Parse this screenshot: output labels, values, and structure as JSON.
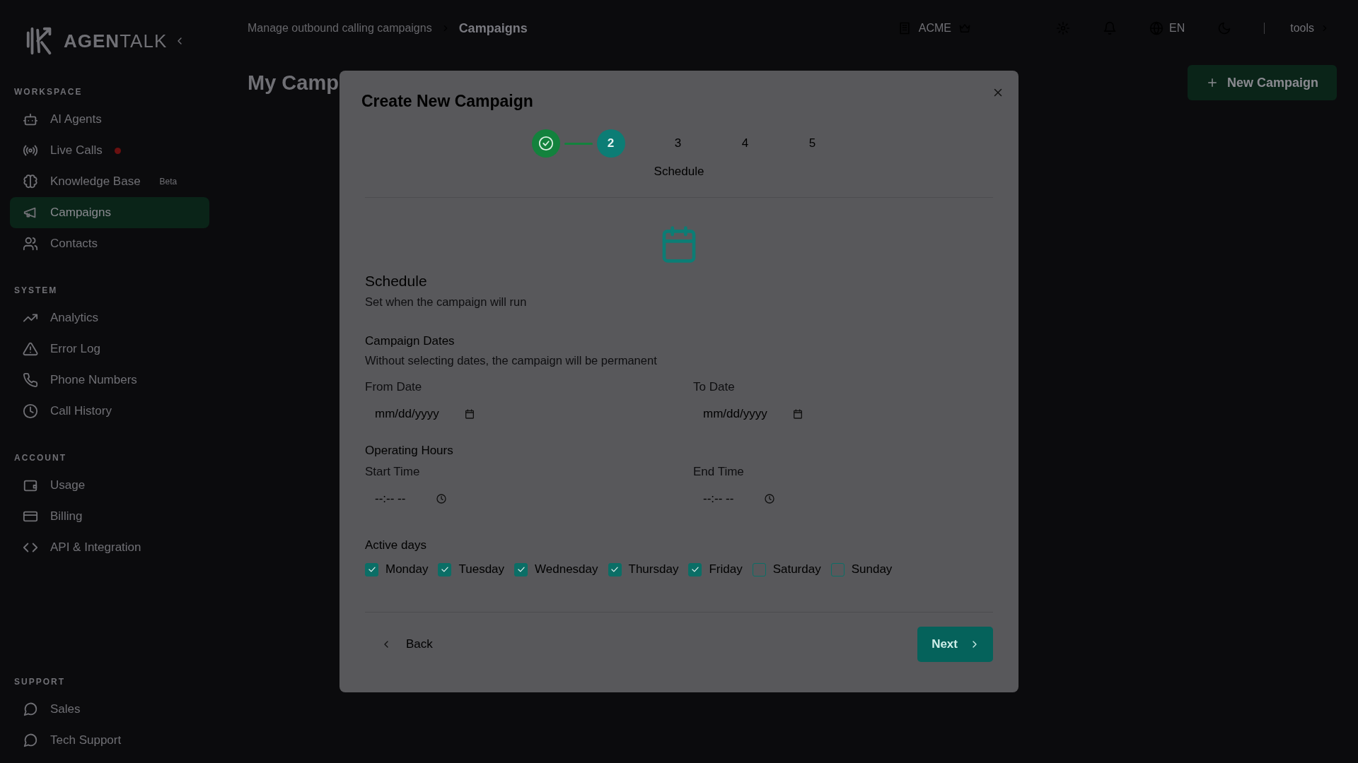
{
  "sidebar": {
    "logo": "**AGEN**TALK",
    "sections": [
      {
        "title": "WORKSPACE",
        "items": [
          {
            "label": "AI Agents",
            "selected": false
          },
          {
            "label": "Live Calls",
            "selected": false,
            "live": true
          },
          {
            "label": "Knowledge Base",
            "selected": false,
            "badge": "Beta"
          },
          {
            "label": "Campaigns",
            "selected": true
          },
          {
            "label": "Contacts",
            "selected": false
          }
        ]
      },
      {
        "title": "SYSTEM",
        "items": [
          {
            "label": "Analytics",
            "selected": false
          },
          {
            "label": "Error Log",
            "selected": false
          },
          {
            "label": "Phone Numbers",
            "selected": false
          },
          {
            "label": "Call History",
            "selected": false
          }
        ]
      },
      {
        "title": "ACCOUNT",
        "items": [
          {
            "label": "Usage",
            "selected": false
          },
          {
            "label": "Billing",
            "selected": false
          },
          {
            "label": "API & Integration",
            "selected": false
          }
        ]
      },
      {
        "title": "SUPPORT",
        "items": [
          {
            "label": "Sales",
            "selected": false
          },
          {
            "label": "Tech Support",
            "selected": false
          }
        ]
      }
    ]
  },
  "topbar": {
    "breadcrumb": [
      "Manage outbound calling campaigns",
      "Campaigns"
    ],
    "organization": "ACME",
    "language": "EN",
    "user": "tools"
  },
  "page": {
    "title": "My Camp",
    "new_button": "New Campaign"
  },
  "modal": {
    "title": "Create New Campaign",
    "steps": [
      {
        "done": true,
        "selected": false
      },
      {
        "number": "2",
        "done": false,
        "selected": true
      },
      {
        "number": "3",
        "done": false,
        "selected": false
      },
      {
        "number": "4",
        "done": false,
        "selected": false
      },
      {
        "number": "5",
        "done": false,
        "selected": false
      }
    ],
    "step_caption": "Schedule",
    "section": {
      "heading": "Schedule",
      "description": "Set when the campaign will run"
    },
    "dates": {
      "heading": "Campaign Dates",
      "note": "Without selecting dates, the campaign will be permanent",
      "fields": [
        {
          "label": "From Date",
          "placeholder": "mm/dd/yyyy",
          "kind": "date"
        },
        {
          "label": "To Date",
          "placeholder": "mm/dd/yyyy",
          "kind": "date"
        }
      ]
    },
    "hours": {
      "heading": "Operating Hours",
      "fields": [
        {
          "label": "Start Time",
          "placeholder": "--:-- --",
          "kind": "time"
        },
        {
          "label": "End Time",
          "placeholder": "--:-- --",
          "kind": "time"
        }
      ]
    },
    "days": {
      "heading": "Active days",
      "items": [
        {
          "label": "Monday",
          "checked": true
        },
        {
          "label": "Tuesday",
          "checked": true
        },
        {
          "label": "Wednesday",
          "checked": true
        },
        {
          "label": "Thursday",
          "checked": true
        },
        {
          "label": "Friday",
          "checked": true
        },
        {
          "label": "Saturday",
          "checked": false
        },
        {
          "label": "Sunday",
          "checked": false
        }
      ]
    },
    "back": "Back",
    "next": "Next"
  }
}
